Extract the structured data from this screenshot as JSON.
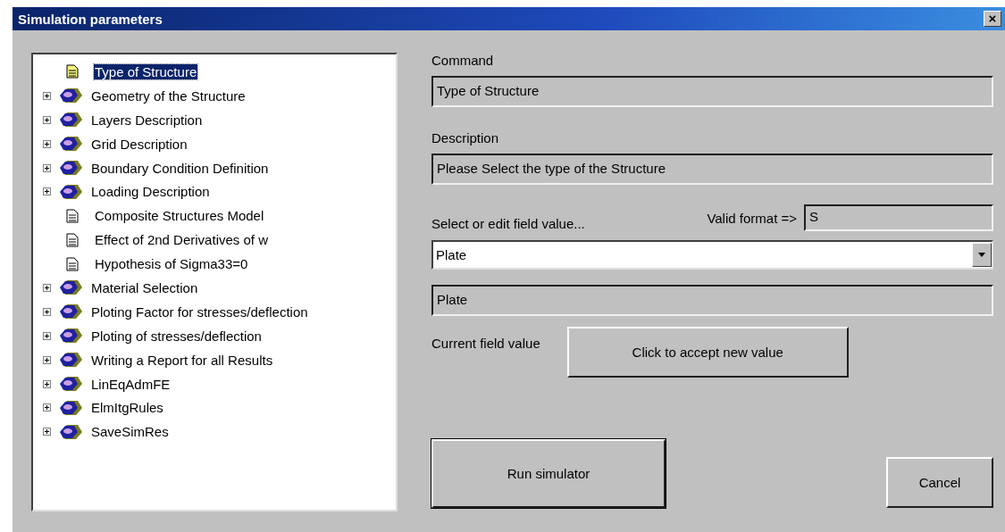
{
  "window": {
    "title": "Simulation parameters",
    "close_label": "×"
  },
  "tree": {
    "items": [
      {
        "label": "Type of Structure",
        "kind": "document",
        "selected": true
      },
      {
        "label": "Geometry of the Structure",
        "kind": "folder",
        "expanded": false,
        "selected": false
      },
      {
        "label": "Layers Description",
        "kind": "folder",
        "expanded": false,
        "selected": false
      },
      {
        "label": "Grid Description",
        "kind": "folder",
        "expanded": false,
        "selected": false
      },
      {
        "label": "Boundary Condition Definition",
        "kind": "folder",
        "expanded": false,
        "selected": false
      },
      {
        "label": "Loading Description",
        "kind": "folder",
        "expanded": false,
        "selected": false
      },
      {
        "label": "Composite Structures Model",
        "kind": "document",
        "selected": false
      },
      {
        "label": "Effect of 2nd Derivatives of w",
        "kind": "document",
        "selected": false
      },
      {
        "label": "Hypothesis of Sigma33=0",
        "kind": "document",
        "selected": false
      },
      {
        "label": "Material Selection",
        "kind": "folder",
        "expanded": false,
        "selected": false
      },
      {
        "label": "Ploting Factor for stresses/deflection",
        "kind": "folder",
        "expanded": false,
        "selected": false
      },
      {
        "label": "Ploting of stresses/deflection",
        "kind": "folder",
        "expanded": false,
        "selected": false
      },
      {
        "label": "Writing a Report for all Results",
        "kind": "folder",
        "expanded": false,
        "selected": false
      },
      {
        "label": "LinEqAdmFE",
        "kind": "folder",
        "expanded": false,
        "selected": false
      },
      {
        "label": "ElmItgRules",
        "kind": "folder",
        "expanded": false,
        "selected": false
      },
      {
        "label": "SaveSimRes",
        "kind": "folder",
        "expanded": false,
        "selected": false
      }
    ]
  },
  "command": {
    "label": "Command",
    "value": "Type of Structure"
  },
  "description": {
    "label": "Description",
    "value": "Please Select the type of the Structure"
  },
  "field_select": {
    "label": "Select or edit field value...",
    "valid_format_label": "Valid format =>",
    "valid_format": "S",
    "value": "Plate"
  },
  "current_value": {
    "label": "Current field value",
    "value": "Plate"
  },
  "buttons": {
    "accept": "Click to accept new value",
    "run": "Run simulator",
    "cancel": "Cancel"
  }
}
